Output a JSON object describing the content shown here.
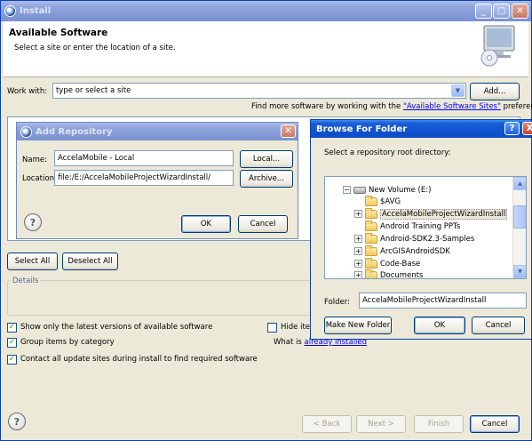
{
  "main": {
    "title": "Install",
    "heading": "Available Software",
    "subheading": "Select a site or enter the location of a site.",
    "work_with_label": "Work with:",
    "work_with_placeholder": "type or select a site",
    "add_button": "Add...",
    "find_more_prefix": "Find more software by working with the ",
    "find_more_link": "\"Available Software Sites\"",
    "find_more_suffix": " preferences.",
    "select_all": "Select All",
    "deselect_all": "Deselect All",
    "details_label": "Details",
    "options": [
      {
        "label": "Show only the latest versions of available software",
        "checked": true
      },
      {
        "label": "Group items by category",
        "checked": true
      },
      {
        "label": "Contact all update sites during install to find required software",
        "checked": true
      }
    ],
    "hide_items_label": "Hide items",
    "what_is_label": "What is ",
    "what_is_link": "already installed",
    "back_button": "< Back",
    "next_button": "Next >",
    "finish_button": "Finish",
    "cancel_button": "Cancel",
    "help_icon": "?"
  },
  "add_repository": {
    "title": "Add Repository",
    "name_label": "Name:",
    "name_value": "AccelaMobile - Local",
    "location_label": "Location:",
    "location_value": "file:/E:/AccelaMobileProjectWizardInstall/",
    "local_button": "Local...",
    "archive_button": "Archive...",
    "ok_button": "OK",
    "cancel_button": "Cancel",
    "help_icon": "?"
  },
  "browse_folder": {
    "title": "Browse For Folder",
    "instruction": "Select a repository root directory:",
    "tree": [
      {
        "label": "New Volume (E:)",
        "level": 0,
        "expander": "−",
        "type": "drive",
        "selected": false
      },
      {
        "label": "$AVG",
        "level": 1,
        "expander": "",
        "type": "folder",
        "selected": false
      },
      {
        "label": "AccelaMobileProjectWizardInstall",
        "level": 1,
        "expander": "+",
        "type": "folder",
        "selected": true
      },
      {
        "label": "Android Training PPTs",
        "level": 1,
        "expander": "",
        "type": "folder",
        "selected": false
      },
      {
        "label": "Android-SDK2.3-Samples",
        "level": 1,
        "expander": "+",
        "type": "folder",
        "selected": false
      },
      {
        "label": "ArcGISAndroidSDK",
        "level": 1,
        "expander": "+",
        "type": "folder",
        "selected": false
      },
      {
        "label": "Code-Base",
        "level": 1,
        "expander": "+",
        "type": "folder",
        "selected": false
      },
      {
        "label": "Documents",
        "level": 1,
        "expander": "+",
        "type": "folder",
        "selected": false
      }
    ],
    "folder_label": "Folder:",
    "folder_value": "AccelaMobileProjectWizardInstall",
    "make_new_folder_button": "Make New Folder",
    "ok_button": "OK",
    "cancel_button": "Cancel",
    "help_button": "?",
    "close_button": "X"
  },
  "colors": {
    "title_active": "#0d4bc4",
    "title_inactive": "#8399d6",
    "window_bg": "#ece9d8",
    "link": "#0000ff"
  }
}
